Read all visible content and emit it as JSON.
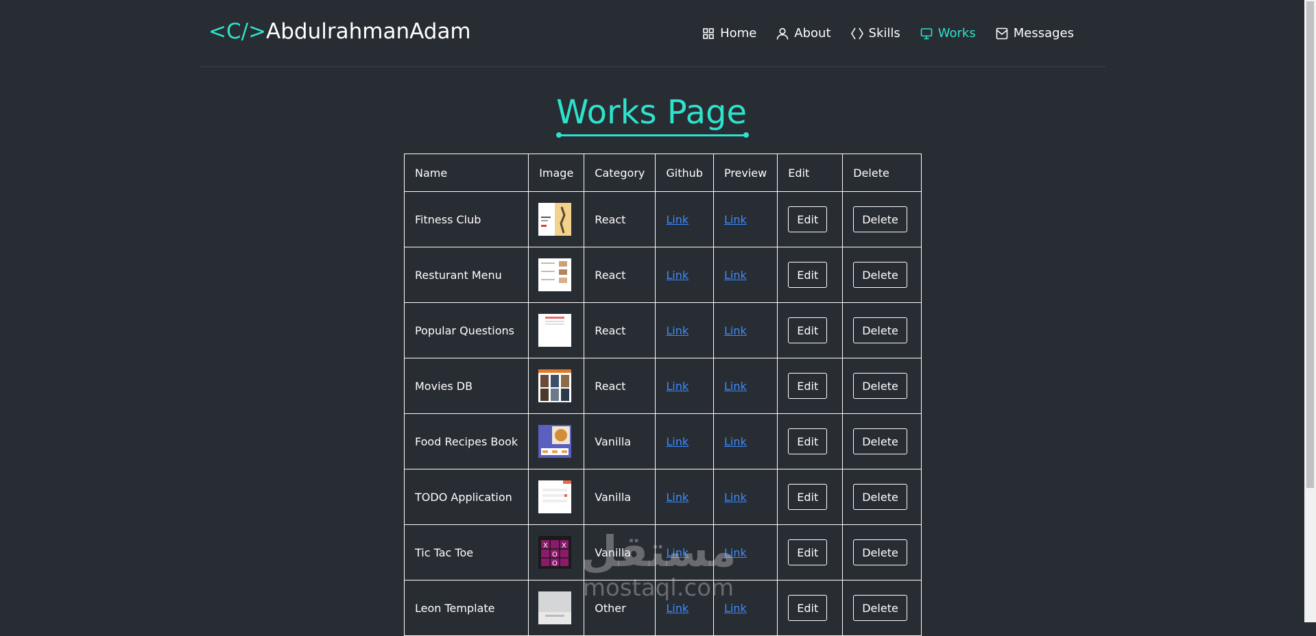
{
  "brand": {
    "code": "<C/>",
    "name": "AbdulrahmanAdam"
  },
  "nav": [
    {
      "label": "Home",
      "icon": "grid-icon",
      "active": false
    },
    {
      "label": "About",
      "icon": "user-icon",
      "active": false
    },
    {
      "label": "Skills",
      "icon": "code-brackets-icon",
      "active": false
    },
    {
      "label": "Works",
      "icon": "monitor-icon",
      "active": true
    },
    {
      "label": "Messages",
      "icon": "envelope-icon",
      "active": false
    }
  ],
  "page_title": "Works Page",
  "table": {
    "headers": [
      "Name",
      "Image",
      "Category",
      "Github",
      "Preview",
      "Edit",
      "Delete"
    ],
    "rows": [
      {
        "name": "Fitness Club",
        "category": "React",
        "github": "Link",
        "preview": "Link",
        "edit": "Edit",
        "delete": "Delete"
      },
      {
        "name": "Resturant Menu",
        "category": "React",
        "github": "Link",
        "preview": "Link",
        "edit": "Edit",
        "delete": "Delete"
      },
      {
        "name": "Popular Questions",
        "category": "React",
        "github": "Link",
        "preview": "Link",
        "edit": "Edit",
        "delete": "Delete"
      },
      {
        "name": "Movies DB",
        "category": "React",
        "github": "Link",
        "preview": "Link",
        "edit": "Edit",
        "delete": "Delete"
      },
      {
        "name": "Food Recipes Book",
        "category": "Vanilla",
        "github": "Link",
        "preview": "Link",
        "edit": "Edit",
        "delete": "Delete"
      },
      {
        "name": "TODO Application",
        "category": "Vanilla",
        "github": "Link",
        "preview": "Link",
        "edit": "Edit",
        "delete": "Delete"
      },
      {
        "name": "Tic Tac Toe",
        "category": "Vanilla",
        "github": "Link",
        "preview": "Link",
        "edit": "Edit",
        "delete": "Delete"
      },
      {
        "name": "Leon Template",
        "category": "Other",
        "github": "Link",
        "preview": "Link",
        "edit": "Edit",
        "delete": "Delete"
      }
    ]
  },
  "watermark": {
    "arabic": "مستقل",
    "latin": "mostaql.com"
  },
  "colors": {
    "background": "#282c33",
    "accent": "#2de3cc",
    "link": "#3b8cff"
  }
}
